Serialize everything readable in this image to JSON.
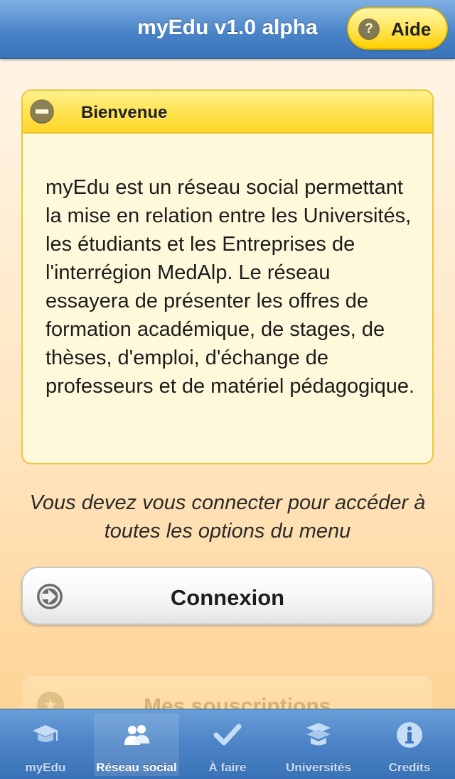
{
  "header": {
    "title": "myEdu v1.0 alpha",
    "help_label": "Aide",
    "help_icon": "question-circle-icon"
  },
  "welcome_panel": {
    "title": "Bienvenue",
    "collapse_icon": "minus-circle-icon",
    "body": "myEdu est un réseau social permettant la mise en relation entre les Universités, les étudiants et les Entreprises de l'interrégion MedAlp. Le réseau essayera de présenter les offres de formation académique, de stages, de thèses, d'emploi, d'échange de professeurs et de matériel pédagogique."
  },
  "notice": "Vous devez vous connecter pour accéder à toutes les options du menu",
  "login": {
    "label": "Connexion",
    "icon": "login-arrow-icon"
  },
  "subscriptions_panel": {
    "label": "Mes souscriptions",
    "icon": "star-icon"
  },
  "tabbar": {
    "tabs": [
      {
        "label": "myEdu",
        "icon": "graduation-cap-icon",
        "active": false
      },
      {
        "label": "Réseau social",
        "icon": "people-icon",
        "active": true
      },
      {
        "label": "À faire",
        "icon": "checkmark-icon",
        "active": false
      },
      {
        "label": "Universités",
        "icon": "university-icon",
        "active": false
      },
      {
        "label": "Credits",
        "icon": "info-icon",
        "active": false
      }
    ]
  },
  "colors": {
    "nav_blue": "#4a84c8",
    "accent_yellow": "#ffe24c",
    "background_orange": "#ffcf8a"
  }
}
